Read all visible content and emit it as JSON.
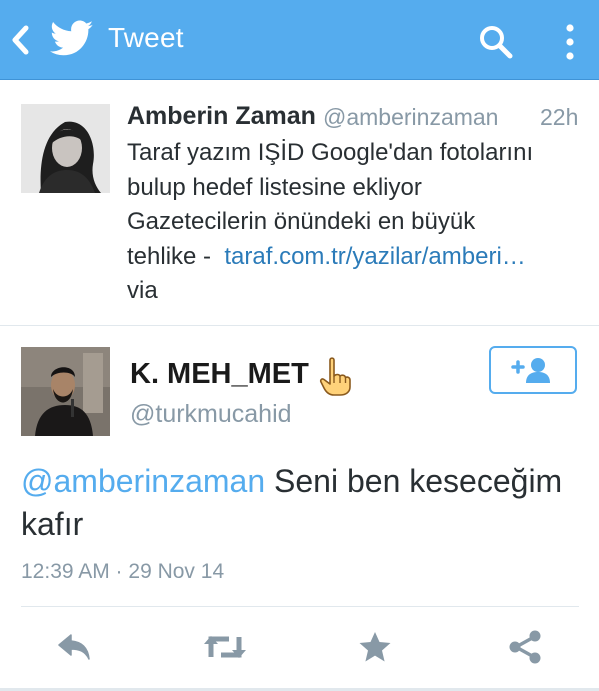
{
  "app_bar": {
    "title": "Tweet",
    "back_icon": "back-chevron-icon",
    "logo_icon": "twitter-bird-icon",
    "search_icon": "search-icon",
    "menu_icon": "overflow-menu-icon",
    "background": "#55acee"
  },
  "tweet": {
    "author_name": "Amberin Zaman",
    "author_handle": "@amberinzaman",
    "time_ago": "22h",
    "text_lines": [
      "Taraf yazım IŞİD Google'dan fotolarını",
      "bulup hedef listesine ekliyor",
      "Gazetecilerin önündeki en büyük"
    ],
    "text_prefix_line4": "tehlike -  ",
    "link_text": "taraf.com.tr/yazilar/amberi…",
    "via_text": "via"
  },
  "reply": {
    "author_name": "K. MEH_MET",
    "author_emoji": "☝",
    "author_handle": "@turkmucahid",
    "follow_button_icon": "follow-user-plus-icon",
    "mention": "@amberinzaman",
    "text_rest": " Seni ben keseceğim",
    "text_line2": "kafır",
    "timestamp": "12:39 AM · 29 Nov 14"
  },
  "actions": {
    "reply_icon": "reply-icon",
    "retweet_icon": "retweet-icon",
    "favorite_icon": "star-icon",
    "share_icon": "share-icon"
  },
  "colors": {
    "accent": "#55acee",
    "link": "#2b7bb9",
    "muted": "#8899a6",
    "text": "#292f33",
    "action_icon": "#8899a6"
  }
}
